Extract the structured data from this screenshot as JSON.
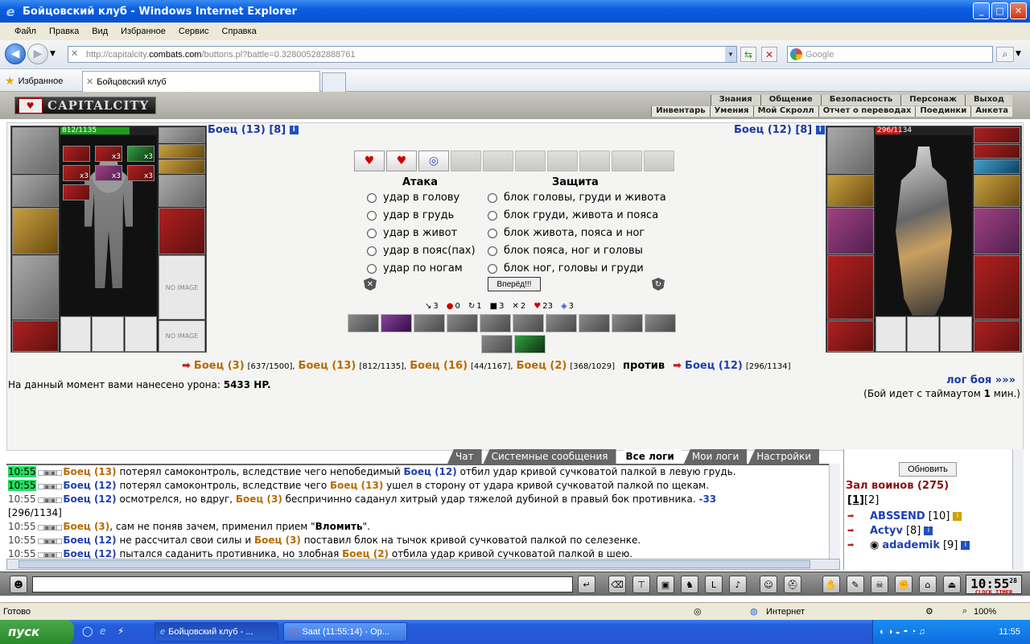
{
  "window": {
    "title": "Бойцовский клуб - Windows Internet Explorer"
  },
  "menu": [
    "Файл",
    "Правка",
    "Вид",
    "Избранное",
    "Сервис",
    "Справка"
  ],
  "address": {
    "prefix": "http://capitalcity.",
    "host": "combats.com",
    "path": "/buttons.pl?battle=0.328005282888761",
    "search_placeholder": "Google"
  },
  "favorites": {
    "label": "Избранное",
    "tab_title": "Бойцовский клуб"
  },
  "site": {
    "logo": "CAPITALCITY",
    "menu1": [
      "Знания",
      "Общение",
      "Безопасность",
      "Персонаж",
      "Выход"
    ],
    "menu2": [
      "Инвентарь",
      "Умения",
      "Мой Скролл",
      "Отчет о переводах",
      "Поединки",
      "Анкета"
    ]
  },
  "left_fighter": {
    "name": "Боец (13) [8]",
    "hp_text": "812/1135",
    "hp_fraction": 0.715,
    "noimage": "NO IMAGE",
    "counts": [
      "x3",
      "x3",
      "x3",
      "x3",
      "x3"
    ]
  },
  "right_fighter": {
    "name": "Боец (12) [8]",
    "hp_cur": "296",
    "hp_max": "/1134",
    "hp_fraction": 0.261
  },
  "attack": {
    "title": "Атака",
    "options": [
      "удар в голову",
      "удар в грудь",
      "удар в живот",
      "удар в пояс(пах)",
      "удар по ногам"
    ]
  },
  "defense": {
    "title": "Защита",
    "options": [
      "блок головы, груди и живота",
      "блок груди, живота и пояса",
      "блок живота, пояса и ног",
      "блок пояса, ног и головы",
      "блок ног, головы и груди"
    ]
  },
  "forward_button": "Вперёд!!!",
  "stats": [
    "3",
    "0",
    "1",
    "3",
    "2",
    "23",
    "3"
  ],
  "team": {
    "members": [
      {
        "name": "Боец (3)",
        "hp": "[637/1500],"
      },
      {
        "name": "Боец (13)",
        "hp": "[812/1135],"
      },
      {
        "name": "Боец (16)",
        "hp": "[44/1167],"
      },
      {
        "name": "Боец (2)",
        "hp": "[368/1029]"
      }
    ],
    "vs": "против",
    "enemy": {
      "name": "Боец (12)",
      "hp": "[296/1134]"
    }
  },
  "damage": {
    "label": "На данный момент вами нанесено урона:",
    "value": "5433 HP."
  },
  "log_link": "лог боя »»»",
  "timeout": {
    "prefix": "(Бой идет с таймаутом",
    "value": "1",
    "suffix": "мин.)"
  },
  "chat_tabs": [
    "Чат",
    "Системные сообщения",
    "Все логи",
    "Мои логи",
    "Настройки"
  ],
  "log": [
    {
      "time": "10:55",
      "parts": [
        [
          "co",
          "Боец (13)"
        ],
        [
          "t",
          " потерял самоконтроль, вследствие чего непобедимый "
        ],
        [
          "cn",
          "Боец (12)"
        ],
        [
          "t",
          " отбил удар кривой сучковатой палкой в левую грудь."
        ]
      ]
    },
    {
      "time": "10:55",
      "parts": [
        [
          "cn",
          "Боец (12)"
        ],
        [
          "t",
          " потерял самоконтроль, вследствие чего "
        ],
        [
          "co",
          "Боец (13)"
        ],
        [
          "t",
          " ушел в сторону от удара кривой сучковатой палкой по щекам."
        ]
      ]
    },
    {
      "time": "10:55",
      "parts": [
        [
          "cn",
          "Боец (12)"
        ],
        [
          "t",
          " осмотрелся, но вдруг, "
        ],
        [
          "co",
          "Боец (3)"
        ],
        [
          "t",
          " беспричинно саданул хитрый удар тяжелой дубиной в правый бок противника. "
        ],
        [
          "num",
          "-33"
        ]
      ]
    },
    {
      "time": "",
      "parts": [
        [
          "t",
          "[296/1134]"
        ]
      ]
    },
    {
      "time": "10:55",
      "parts": [
        [
          "co",
          "Боец (3)"
        ],
        [
          "t",
          ", сам не поняв зачем, применил прием \""
        ],
        [
          "b",
          "Вломить"
        ],
        [
          "t",
          "\"."
        ]
      ]
    },
    {
      "time": "10:55",
      "parts": [
        [
          "cn",
          "Боец (12)"
        ],
        [
          "t",
          " не рассчитал свои силы и "
        ],
        [
          "co",
          "Боец (3)"
        ],
        [
          "t",
          " поставил блок на тычок кривой сучковатой палкой по селезенке."
        ]
      ]
    },
    {
      "time": "10:55",
      "parts": [
        [
          "cn",
          "Боец (12)"
        ],
        [
          "t",
          " пытался саданить противника, но злобная "
        ],
        [
          "co",
          "Боец (2)"
        ],
        [
          "t",
          " отбила удар кривой сучковатой палкой в шею."
        ]
      ]
    }
  ],
  "room": {
    "refresh": "Обновить",
    "title": "Зал воинов (275)",
    "pages": [
      "[1]",
      "[2]"
    ],
    "users": [
      {
        "name": "ABSSEND",
        "level": "[10]"
      },
      {
        "name": "Actyv",
        "level": "[8]"
      },
      {
        "name": "adademik",
        "level": "[9]"
      }
    ]
  },
  "clock": {
    "time": "10:55",
    "sec": "28",
    "label": "CLOCK TIMER"
  },
  "status": {
    "left": "Готово",
    "zone": "Интернет",
    "zoom": "100%"
  },
  "taskbar": {
    "start": "пуск",
    "tasks": [
      "Бойцовский клуб - ...",
      "Saat (11:55:14) - Op..."
    ],
    "time": "11:55"
  }
}
